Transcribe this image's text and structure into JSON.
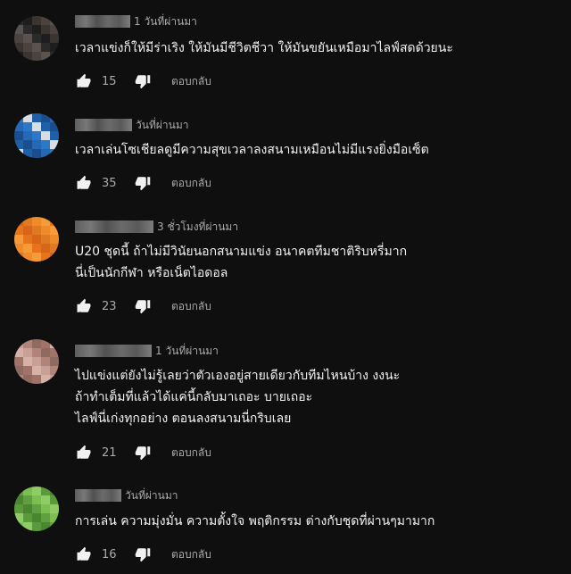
{
  "comments": [
    {
      "time": "1 วันที่ผ่านมา",
      "text": "เวลาแข่งก็ให้มีร่าเริง ให้มันมีชีวิตชีวา ให้มันขยันเหมือมาไลฟ์สดด้วยนะ",
      "likes": "15",
      "reply_label": "ตอบกลับ",
      "avatar_colors": [
        "#2a2a2a",
        "#4a4340",
        "#1e1e1e",
        "#5a524e",
        "#3a3531"
      ]
    },
    {
      "time": "วันที่ผ่านมา",
      "text": "เวลาเล่นโซเชียลดูมีความสุขเวลาลงสนามเหมือนไม่มีแรงยิ่งมือเซ็ต",
      "likes": "35",
      "reply_label": "ตอบกลับ",
      "avatar_colors": [
        "#1f5fa8",
        "#2c78c8",
        "#1a4f8e",
        "#d8dde4",
        "#2668b3"
      ]
    },
    {
      "time": "3 ชั่วโมงที่ผ่านมา",
      "text": "U20 ชุดนี้ ถ้าไม่มีวินัยนอกสนามแข่ง อนาคตทีมชาติริบหรี่มาก\nนี่เป็นนักกีฬา หรือเน็ตไอดอล",
      "likes": "23",
      "reply_label": "ตอบกลับ",
      "avatar_colors": [
        "#e8741a",
        "#f08a2a",
        "#d9651a",
        "#f59b3a",
        "#e07a22"
      ]
    },
    {
      "time": "1 วันที่ผ่านมา",
      "text": "ไปแข่งแต่ยังไม่รู้เลยว่าตัวเองอยู่สายเดียวกับทีมไหนบ้าง งงนะ\nถ้าทำเต็มที่แล้วได้แค่นี้กลับมาเถอะ บายเถอะ\nไลฟ์นี่เก่งทุกอย่าง ตอนลงสนามนี่กริบเลย",
      "likes": "21",
      "reply_label": "ตอบกลับ",
      "avatar_colors": [
        "#b08478",
        "#d6b2a6",
        "#8e6a60",
        "#c9a096",
        "#a07268"
      ]
    },
    {
      "time": "วันที่ผ่านมา",
      "text": "การเล่น ความมุ่งมั่น ความตั้งใจ พฤติกรรม ต่างกับชุดที่ผ่านๆมามาก",
      "likes": "16",
      "reply_label": "ตอบกลับ",
      "avatar_colors": [
        "#5a9a3a",
        "#7bbf52",
        "#4a8530",
        "#8fcc66",
        "#629f40"
      ]
    }
  ]
}
